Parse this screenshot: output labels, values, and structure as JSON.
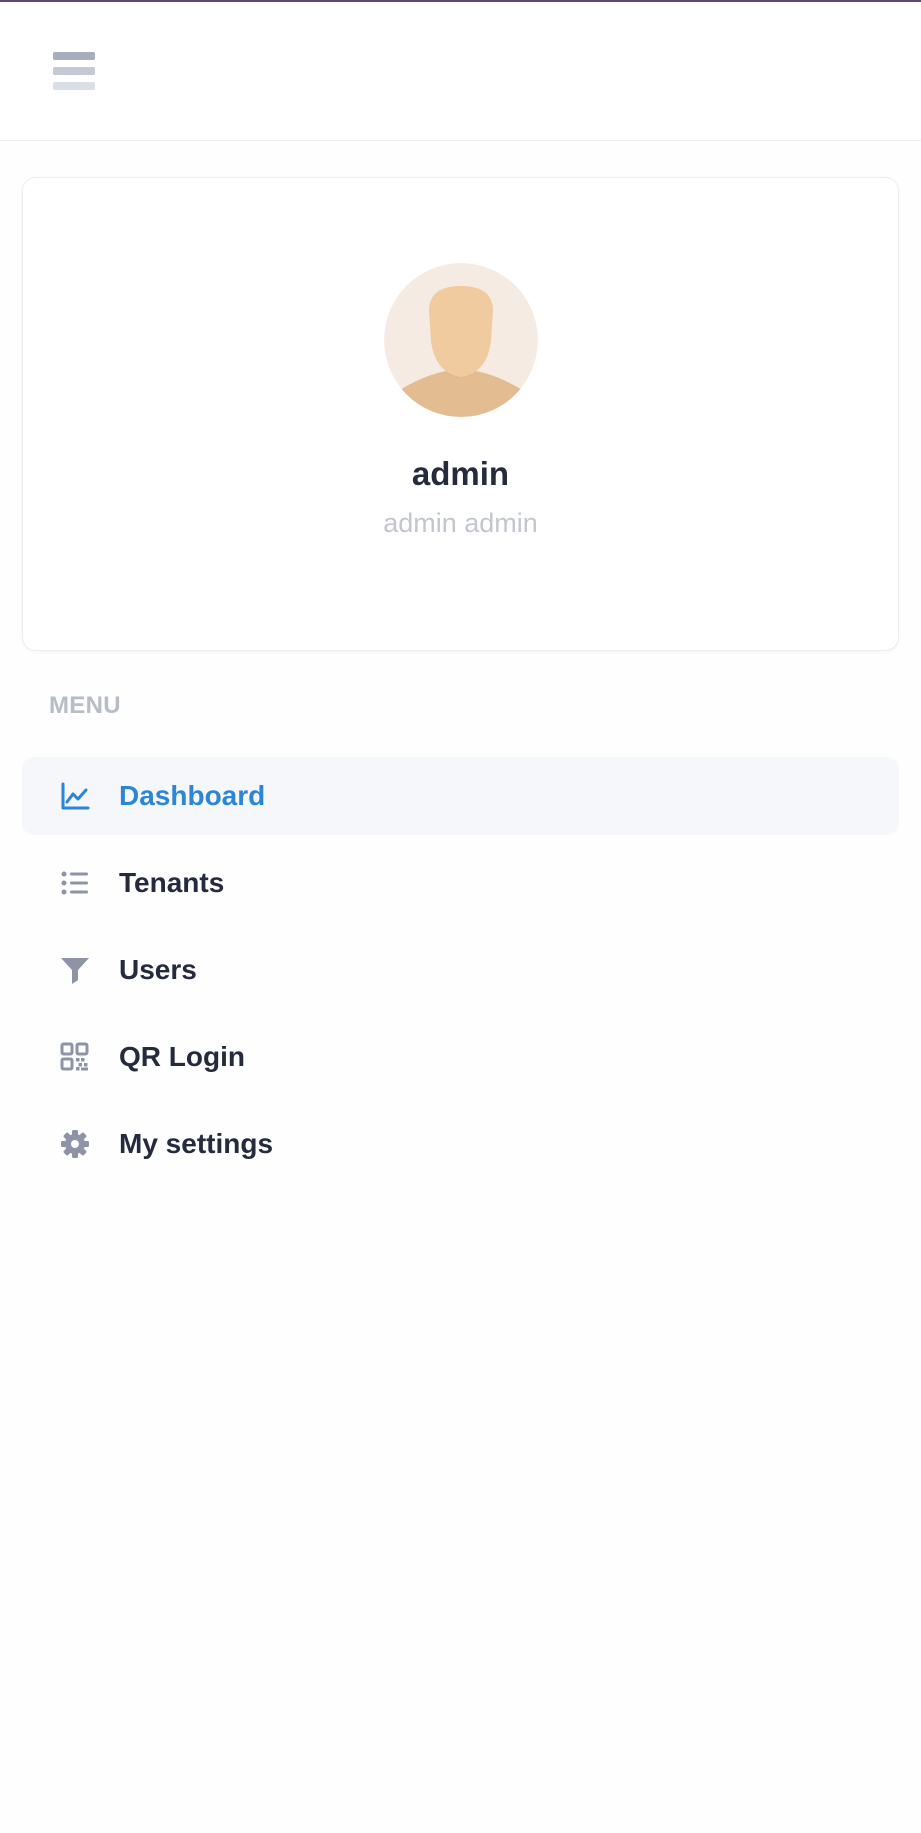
{
  "header": {
    "menu_icon": "hamburger-menu-icon"
  },
  "profile": {
    "avatar_icon": "default-user-avatar",
    "username": "admin",
    "full_name": "admin admin"
  },
  "menu": {
    "heading": "MENU",
    "items": [
      {
        "label": "Dashboard",
        "icon": "chart-line-icon",
        "active": true
      },
      {
        "label": "Tenants",
        "icon": "list-icon",
        "active": false
      },
      {
        "label": "Users",
        "icon": "funnel-icon",
        "active": false
      },
      {
        "label": "QR Login",
        "icon": "qr-code-icon",
        "active": false
      },
      {
        "label": "My settings",
        "icon": "gear-icon",
        "active": false
      }
    ]
  },
  "colors": {
    "accent": "#2d86d5",
    "text": "#252a3d",
    "muted": "#c3c6cf",
    "icon": "#8e94a5",
    "active_bg": "#f5f7fa"
  }
}
